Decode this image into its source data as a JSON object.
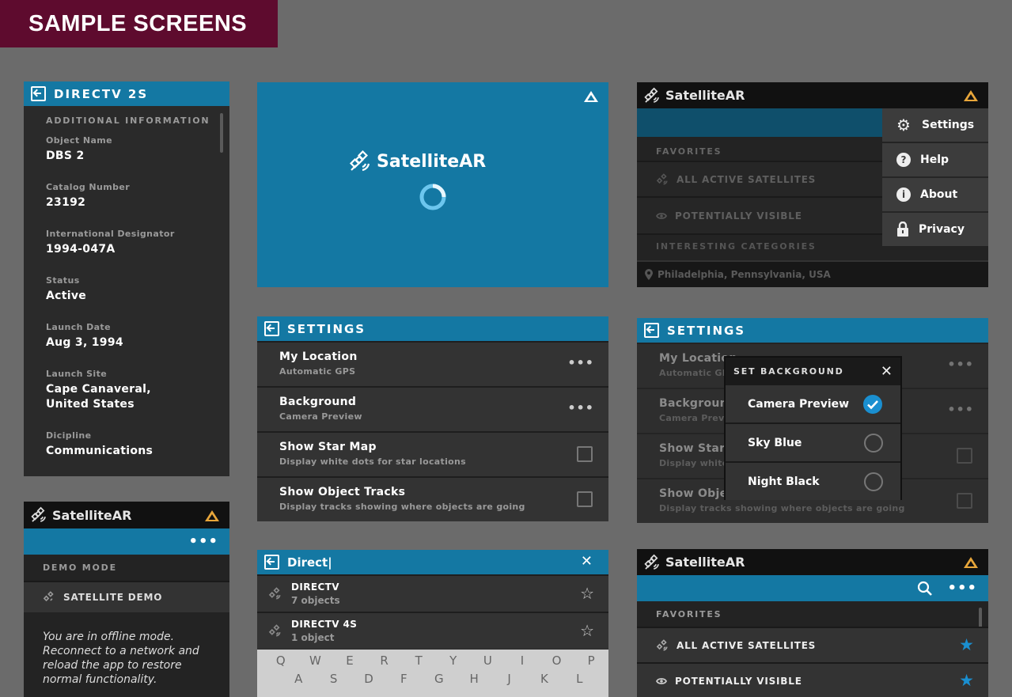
{
  "banner": {
    "title": "SAMPLE SCREENS"
  },
  "colors": {
    "blue": "#1478a3",
    "maroon": "#5e0b2e",
    "accent": "#e8a63a",
    "star": "#1a8fd0"
  },
  "detail": {
    "title": "DIRECTV 2S",
    "section": "ADDITIONAL INFORMATION",
    "fields": [
      {
        "label": "Object Name",
        "value": "DBS 2"
      },
      {
        "label": "Catalog Number",
        "value": "23192"
      },
      {
        "label": "International Designator",
        "value": "1994-047A"
      },
      {
        "label": "Status",
        "value": "Active"
      },
      {
        "label": "Launch Date",
        "value": "Aug 3, 1994"
      },
      {
        "label": "Launch Site",
        "value": "Cape Canaveral, United States"
      },
      {
        "label": "Dicipline",
        "value": "Communications"
      }
    ]
  },
  "splash": {
    "app_name": "SatelliteAR"
  },
  "menu_screen": {
    "app_name": "SatelliteAR",
    "favorites": "FAVORITES",
    "items": [
      "ALL ACTIVE SATELLITES",
      "POTENTIALLY VISIBLE"
    ],
    "categories": "INTERESTING CATEGORIES",
    "location": "Philadelphia, Pennsylvania, USA",
    "dropdown": [
      "Settings",
      "Help",
      "About",
      "Privacy"
    ]
  },
  "settings": {
    "title": "SETTINGS",
    "rows": [
      {
        "title": "My Location",
        "sub": "Automatic GPS",
        "control": "dots"
      },
      {
        "title": "Background",
        "sub": "Camera Preview",
        "control": "dots"
      },
      {
        "title": "Show Star Map",
        "sub": "Display white dots for  star locations",
        "control": "check"
      },
      {
        "title": "Show Object Tracks",
        "sub": "Display tracks showing where objects are going",
        "control": "check"
      }
    ]
  },
  "settings_dialog": {
    "title": "SETTINGS",
    "rows": [
      {
        "title": "My Location",
        "sub": "Automatic GPS"
      },
      {
        "title": "Background",
        "sub": "Camera Preview"
      },
      {
        "title": "Show Star Map",
        "sub": "Display white dots for  star locations"
      },
      {
        "title": "Show Object Tracks",
        "sub": "Display tracks showing where objects are going"
      }
    ],
    "dialog_title": "SET BACKGROUND",
    "options": [
      {
        "label": "Camera Preview",
        "selected": true
      },
      {
        "label": "Sky Blue",
        "selected": false
      },
      {
        "label": "Night Black",
        "selected": false
      }
    ]
  },
  "demo": {
    "app_name": "SatelliteAR",
    "section": "DEMO MODE",
    "item": "SATELLITE DEMO",
    "message": "You are in offline mode. Reconnect to a network and reload the app to restore normal functionality."
  },
  "search": {
    "query": "Direct|",
    "results": [
      {
        "name": "DIRECTV",
        "count": "7 objects"
      },
      {
        "name": "DIRECTV 4S",
        "count": "1 object"
      }
    ],
    "keys_row1": [
      "Q",
      "W",
      "E",
      "R",
      "T",
      "Y",
      "U",
      "I",
      "O",
      "P"
    ],
    "keys_row2": [
      "A",
      "S",
      "D",
      "F",
      "G",
      "H",
      "J",
      "K",
      "L"
    ]
  },
  "favorites_screen": {
    "app_name": "SatelliteAR",
    "favorites": "FAVORITES",
    "items": [
      "ALL ACTIVE SATELLITES",
      "POTENTIALLY VISIBLE"
    ]
  }
}
